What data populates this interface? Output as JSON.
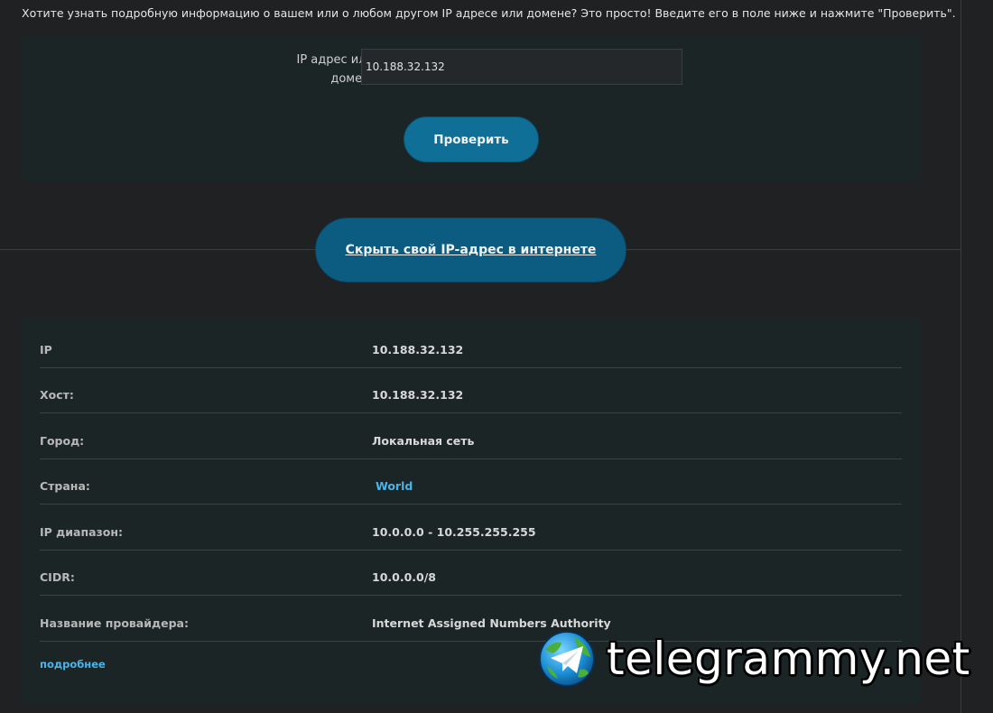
{
  "intro": {
    "text": "Хотите узнать подробную информацию о вашем или о любом другом IP адресе или домене? Это просто! Введите его в поле ниже и нажмите \"Проверить\"."
  },
  "form": {
    "label": "IP адрес или домен:",
    "input_value": "10.188.32.132",
    "check_button": "Проверить"
  },
  "hide_button": "Скрыть свой IP-адрес в интернете",
  "info": {
    "rows": [
      {
        "key": "IP",
        "value": "10.188.32.132"
      },
      {
        "key": "Хост:",
        "value": "10.188.32.132"
      },
      {
        "key": "Город:",
        "value": "Локальная сеть"
      },
      {
        "key": "Страна:",
        "value": "World"
      },
      {
        "key": "IP диапазон:",
        "value": "10.0.0.0 - 10.255.255.255"
      },
      {
        "key": "CIDR:",
        "value": "10.0.0.0/8"
      },
      {
        "key": "Название провайдера:",
        "value": "Internet Assigned Numbers Authority"
      }
    ],
    "more_link": "подробнее"
  },
  "watermark": {
    "text": "telegrammy.net",
    "icon": "telegram-globe-icon"
  },
  "colors": {
    "background": "#1f2122",
    "panel": "#1b2526",
    "button": "#0f6f96",
    "link": "#4db3e6"
  }
}
